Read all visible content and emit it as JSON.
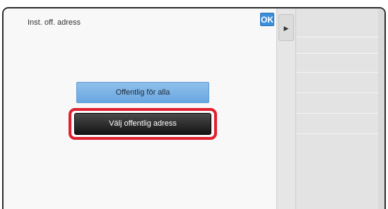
{
  "dialog": {
    "title": "Inst. off. adress",
    "ok_label": "OK",
    "buttons": {
      "public_for_all": "Offentlig för alla",
      "select_public_address": "Välj offentlig adress"
    }
  },
  "side_panel": {
    "tab_icon": "play-arrow-icon",
    "tab_glyph": "▶"
  },
  "colors": {
    "ok_button": "#3b8fdc",
    "public_button": "#7ab3e6",
    "select_button": "#1f1f1f",
    "highlight": "#e02030"
  }
}
